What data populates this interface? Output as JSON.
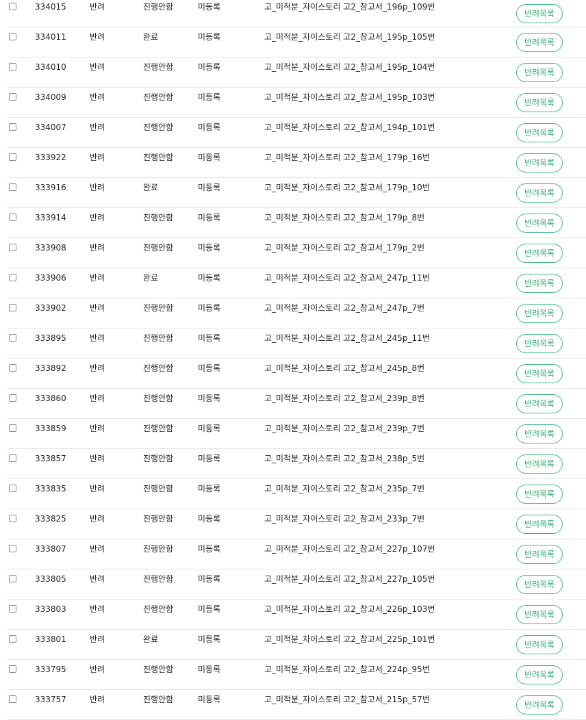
{
  "accent_color": "#3dba7e",
  "rows": [
    {
      "id": "334015",
      "type": "반려",
      "progress": "진행안함",
      "registration": "미등록",
      "title": "고_미적분_자이스토리 고2_참고서_196p_109번",
      "action": "반려목록"
    },
    {
      "id": "334011",
      "type": "반려",
      "progress": "완료",
      "registration": "미등록",
      "title": "고_미적분_자이스토리 고2_참고서_195p_105번",
      "action": "반려목록"
    },
    {
      "id": "334010",
      "type": "반려",
      "progress": "진행안함",
      "registration": "미등록",
      "title": "고_미적분_자이스토리 고2_참고서_195p_104번",
      "action": "반려목록"
    },
    {
      "id": "334009",
      "type": "반려",
      "progress": "진행안함",
      "registration": "미등록",
      "title": "고_미적분_자이스토리 고2_참고서_195p_103번",
      "action": "반려목록"
    },
    {
      "id": "334007",
      "type": "반려",
      "progress": "진행안함",
      "registration": "미등록",
      "title": "고_미적분_자이스토리 고2_참고서_194p_101번",
      "action": "반려목록"
    },
    {
      "id": "333922",
      "type": "반려",
      "progress": "진행안함",
      "registration": "미등록",
      "title": "고_미적분_자이스토리 고2_참고서_179p_16번",
      "action": "반려목록"
    },
    {
      "id": "333916",
      "type": "반려",
      "progress": "완료",
      "registration": "미등록",
      "title": "고_미적분_자이스토리 고2_참고서_179p_10번",
      "action": "반려목록"
    },
    {
      "id": "333914",
      "type": "반려",
      "progress": "진행안함",
      "registration": "미등록",
      "title": "고_미적분_자이스토리 고2_참고서_179p_8번",
      "action": "반려목록"
    },
    {
      "id": "333908",
      "type": "반려",
      "progress": "진행안함",
      "registration": "미등록",
      "title": "고_미적분_자이스토리 고2_참고서_179p_2번",
      "action": "반려목록"
    },
    {
      "id": "333906",
      "type": "반려",
      "progress": "완료",
      "registration": "미등록",
      "title": "고_미적분_자이스토리 고2_참고서_247p_11번",
      "action": "반려목록"
    },
    {
      "id": "333902",
      "type": "반려",
      "progress": "진행안함",
      "registration": "미등록",
      "title": "고_미적분_자이스토리 고2_참고서_247p_7번",
      "action": "반려목록"
    },
    {
      "id": "333895",
      "type": "반려",
      "progress": "진행안함",
      "registration": "미등록",
      "title": "고_미적분_자이스토리 고2_참고서_245p_11번",
      "action": "반려목록"
    },
    {
      "id": "333892",
      "type": "반려",
      "progress": "진행안함",
      "registration": "미등록",
      "title": "고_미적분_자이스토리 고2_참고서_245p_8번",
      "action": "반려목록"
    },
    {
      "id": "333860",
      "type": "반려",
      "progress": "진행안함",
      "registration": "미등록",
      "title": "고_미적분_자이스토리 고2_참고서_239p_8번",
      "action": "반려목록"
    },
    {
      "id": "333859",
      "type": "반려",
      "progress": "진행안함",
      "registration": "미등록",
      "title": "고_미적분_자이스토리 고2_참고서_239p_7번",
      "action": "반려목록"
    },
    {
      "id": "333857",
      "type": "반려",
      "progress": "진행안함",
      "registration": "미등록",
      "title": "고_미적분_자이스토리 고2_참고서_238p_5번",
      "action": "반려목록"
    },
    {
      "id": "333835",
      "type": "반려",
      "progress": "진행안함",
      "registration": "미등록",
      "title": "고_미적분_자이스토리 고2_참고서_235p_7번",
      "action": "반려목록"
    },
    {
      "id": "333825",
      "type": "반려",
      "progress": "진행안함",
      "registration": "미등록",
      "title": "고_미적분_자이스토리 고2_참고서_233p_7번",
      "action": "반려목록"
    },
    {
      "id": "333807",
      "type": "반려",
      "progress": "진행안함",
      "registration": "미등록",
      "title": "고_미적분_자이스토리 고2_참고서_227p_107번",
      "action": "반려목록"
    },
    {
      "id": "333805",
      "type": "반려",
      "progress": "진행안함",
      "registration": "미등록",
      "title": "고_미적분_자이스토리 고2_참고서_227p_105번",
      "action": "반려목록"
    },
    {
      "id": "333803",
      "type": "반려",
      "progress": "진행안함",
      "registration": "미등록",
      "title": "고_미적분_자이스토리 고2_참고서_226p_103번",
      "action": "반려목록"
    },
    {
      "id": "333801",
      "type": "반려",
      "progress": "완료",
      "registration": "미등록",
      "title": "고_미적분_자이스토리 고2_참고서_225p_101번",
      "action": "반려목록"
    },
    {
      "id": "333795",
      "type": "반려",
      "progress": "진행안함",
      "registration": "미등록",
      "title": "고_미적분_자이스토리 고2_참고서_224p_95번",
      "action": "반려목록"
    },
    {
      "id": "333757",
      "type": "반려",
      "progress": "진행안함",
      "registration": "미등록",
      "title": "고_미적분_자이스토리 고2_참고서_215p_57번",
      "action": "반려목록"
    }
  ]
}
